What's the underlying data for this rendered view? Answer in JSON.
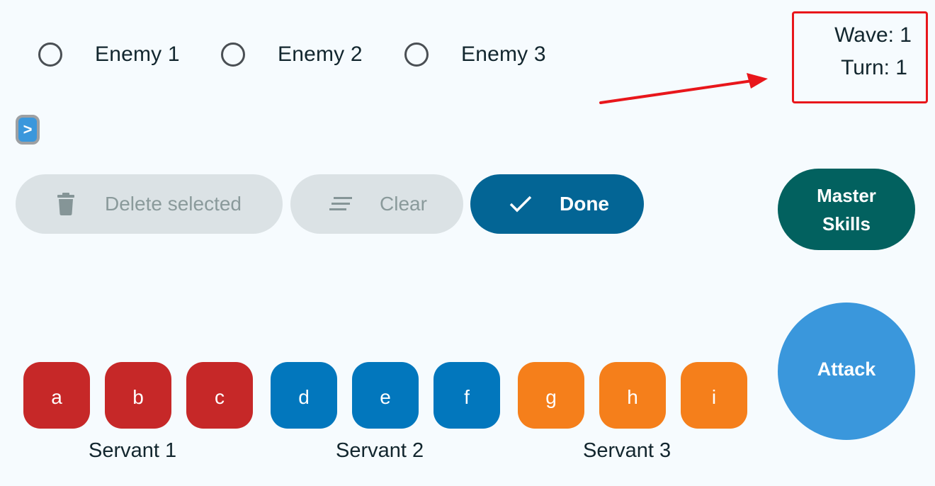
{
  "enemies": [
    {
      "label": "Enemy 1",
      "selected": false
    },
    {
      "label": "Enemy 2",
      "selected": false
    },
    {
      "label": "Enemy 3",
      "selected": false
    }
  ],
  "status": {
    "wave": "Wave: 1",
    "turn": "Turn: 1"
  },
  "annotation": {
    "box_color": "#e8161b",
    "arrow_color": "#e8161b"
  },
  "expand_button": {
    "label": ">"
  },
  "toolbar": {
    "delete_label": "Delete selected",
    "delete_icon": "trash-icon",
    "clear_label": "Clear",
    "clear_icon": "clear-all-icon",
    "done_label": "Done",
    "done_icon": "check-icon"
  },
  "actions": {
    "master_skills_line1": "Master",
    "master_skills_line2": "Skills",
    "attack_label": "Attack"
  },
  "servants": [
    {
      "label": "Servant 1",
      "color": "#c62828",
      "cards": [
        "a",
        "b",
        "c"
      ]
    },
    {
      "label": "Servant 2",
      "color": "#0277bd",
      "cards": [
        "d",
        "e",
        "f"
      ]
    },
    {
      "label": "Servant 3",
      "color": "#f57f1b",
      "cards": [
        "g",
        "h",
        "i"
      ]
    }
  ],
  "colors": {
    "background": "#f6fbfe",
    "disabled_button": "#dbe2e5",
    "done_button": "#036595",
    "master_skills": "#02615f",
    "attack": "#3a97dc"
  }
}
